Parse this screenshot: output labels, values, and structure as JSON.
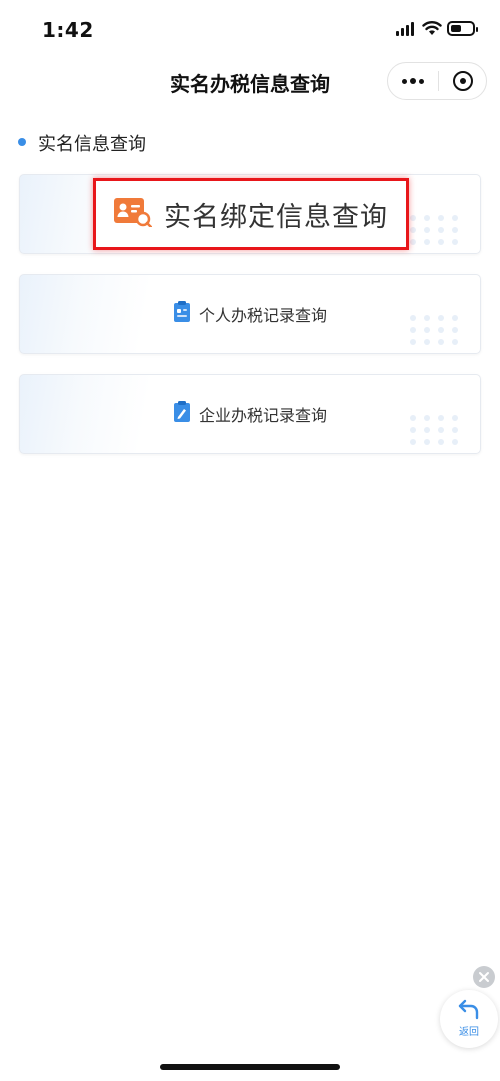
{
  "status_bar": {
    "time": "1:42"
  },
  "nav": {
    "title": "实名办税信息查询",
    "more_icon": "more-dots-icon",
    "close_icon": "target-circle-icon"
  },
  "section": {
    "title": "实名信息查询",
    "bullet_color": "#3a8ee6"
  },
  "cards": [
    {
      "label": "实名绑定信息查询",
      "icon": "id-card-search-icon",
      "icon_color": "#f07a3a"
    },
    {
      "label": "个人办税记录查询",
      "icon": "clipboard-icon",
      "icon_color": "#3a8ee6"
    },
    {
      "label": "企业办税记录查询",
      "icon": "clipboard-edit-icon",
      "icon_color": "#3a8ee6"
    }
  ],
  "floating": {
    "back_label": "返回",
    "back_icon": "return-arrow-icon",
    "close_icon": "close-icon"
  },
  "colors": {
    "highlight_border": "#e8161a",
    "accent": "#3a8ee6"
  }
}
